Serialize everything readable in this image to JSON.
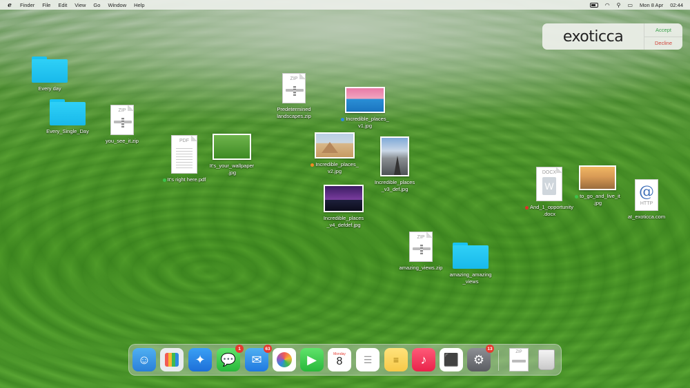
{
  "menubar": {
    "apple_logo": "exoticca-logo-icon",
    "app_name": "Finder",
    "menus": [
      "File",
      "Edit",
      "View",
      "Go",
      "Window",
      "Help"
    ],
    "date": "Mon 8 Apr",
    "time": "02:44"
  },
  "notification": {
    "brand": "exoticca",
    "accept_label": "Accept",
    "decline_label": "Decline"
  },
  "desktop": {
    "every_day": "Every day",
    "every_single_day": "Every_Single_Day",
    "you_see_it_zip": "you_see_it.zip",
    "zip_type": "ZIP",
    "pdf_type": "PDF",
    "docx_type": "DOCX",
    "http_type": "HTTP",
    "pdf_label": "It's right here.pdf",
    "wallpaper_label": "It's_your_wallpaper\n.jpg",
    "predetermined_label": "Predetermined\nlandscapes.zip",
    "inc_v1_label": "Incredible_places_\nv1.jpg",
    "inc_v2_label": "Incredible_places_\nv2.jpg",
    "inc_v3_label": "Incredible_places\n_v3_def.jpg",
    "inc_v4_label": "Incredible_places\n_v4_defdef.jpg",
    "amazing_zip_label": "amazing_views.zip",
    "amazing_folder_label": "amazing_amazing\n_views",
    "docx_label": "And_1_opportunity\n.docx",
    "to_go_label": "to_go_and_live_it\n.jpg",
    "at_exoticca_label": "at_exoticca.com"
  },
  "dock": {
    "messages_badge": "1",
    "mail_badge": "63",
    "settings_badge": "13",
    "calendar_day_name": "Monday",
    "calendar_day_num": "8",
    "zip_type": "ZIP"
  },
  "colors": {
    "folder": "#19c3f2",
    "accept": "#3aa24b",
    "decline": "#d0443a",
    "badge": "#e53a2f",
    "tag_blue": "#2e8be0",
    "tag_orange": "#f08a24",
    "tag_red": "#e0302a",
    "tag_green": "#3cc24a"
  }
}
